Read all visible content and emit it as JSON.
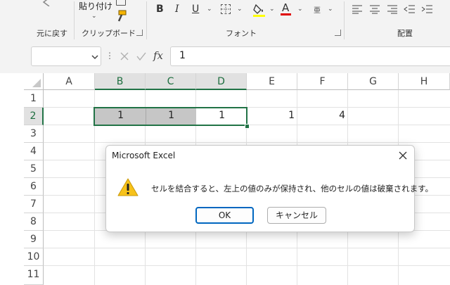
{
  "ribbon": {
    "undo_group_label": "元に戻す",
    "paste_label": "貼り付け",
    "clipboard_group_label": "クリップボード",
    "font_group_label": "フォント",
    "alignment_group_label": "配置",
    "bold": "B",
    "italic": "I",
    "underline": "U",
    "font_color_letter": "A",
    "furigana": "亜",
    "highlight_color": "#ffff00",
    "font_color": "#e00000"
  },
  "formula_bar": {
    "name_box": "",
    "fx_label": "fx",
    "value": "1"
  },
  "columns": [
    "A",
    "B",
    "C",
    "D",
    "E",
    "F",
    "G",
    "H"
  ],
  "rows": [
    "1",
    "2",
    "3",
    "4",
    "5",
    "6",
    "7",
    "8",
    "9",
    "10",
    "11"
  ],
  "cells": {
    "B2": "1",
    "C2": "1",
    "D2": "1",
    "E2": "1",
    "F2": "4"
  },
  "dialog": {
    "title": "Microsoft Excel",
    "message": "セルを結合すると、左上の値のみが保持され、他のセルの値は破棄されます。",
    "ok_label": "OK",
    "cancel_label": "キャンセル",
    "icon": "warning-icon",
    "accent_color": "#0067c0"
  }
}
